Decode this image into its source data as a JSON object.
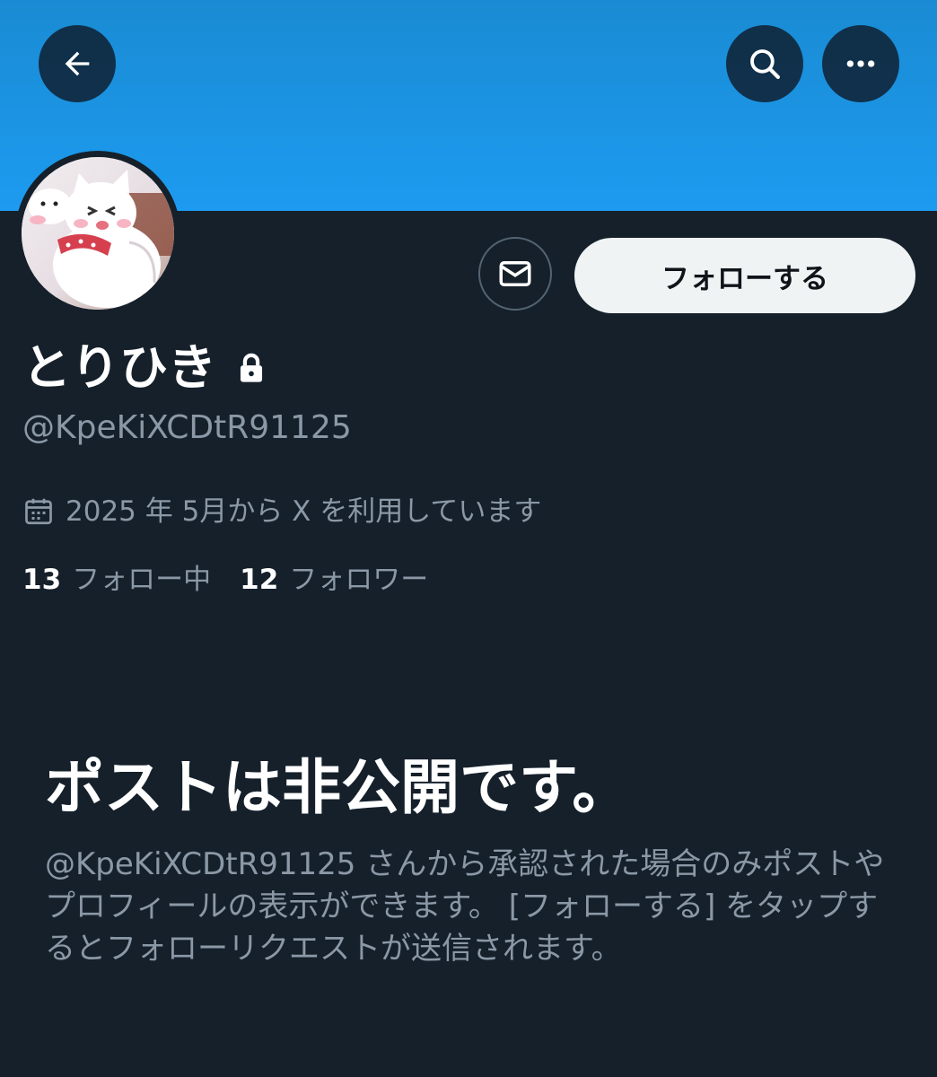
{
  "profile": {
    "display_name": "とりひき",
    "handle": "@KpeKiXCDtR91125",
    "joined": "2025 年 5月から X を利用しています",
    "following_count": "13",
    "following_label": "フォロー中",
    "followers_count": "12",
    "followers_label": "フォロワー"
  },
  "actions": {
    "follow_label": "フォローする"
  },
  "private_notice": {
    "title": "ポストは非公開です。",
    "description": "@KpeKiXCDtR91125 さんから承認された場合のみポストやプロフィールの表示ができます。 [フォローする] をタップするとフォローリクエストが送信されます。"
  },
  "icons": {
    "back": "arrow-left-icon",
    "search": "search-icon",
    "more": "more-horizontal-icon",
    "message": "envelope-icon",
    "protected": "lock-icon",
    "joined": "calendar-icon"
  },
  "colors": {
    "background": "#15202b",
    "banner": "#1d9bf0",
    "secondary_text": "#8b98a5",
    "follow_button_bg": "#eff3f4"
  }
}
